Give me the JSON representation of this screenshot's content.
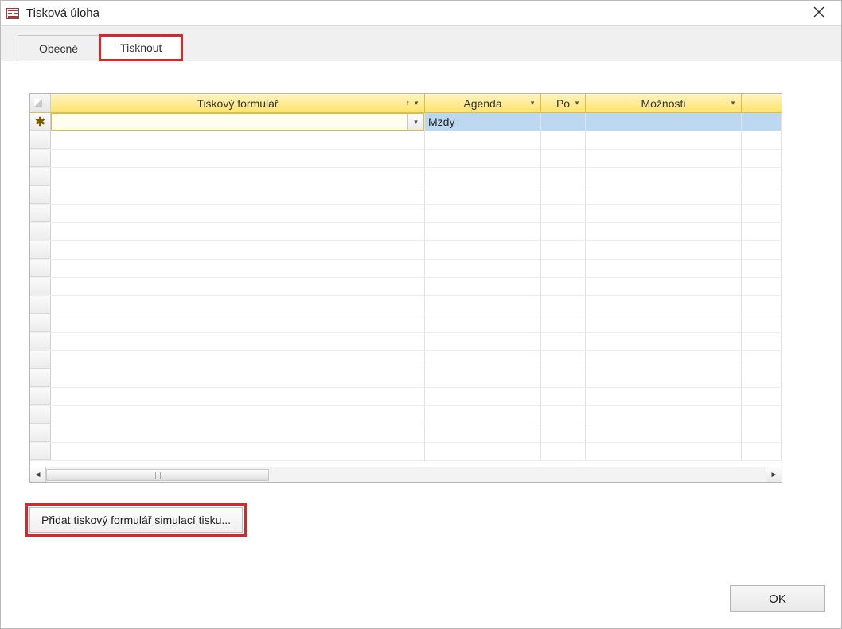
{
  "window": {
    "title": "Tisková úloha"
  },
  "tabs": {
    "items": [
      {
        "label": "Obecné",
        "active": false
      },
      {
        "label": "Tisknout",
        "active": true,
        "highlight": true
      }
    ]
  },
  "grid": {
    "columns": {
      "col1": "Tiskový formulář",
      "col2": "Agenda",
      "col3": "Po",
      "col4": "Možnosti"
    },
    "rows": [
      {
        "new": true,
        "form": "",
        "agenda": "Mzdy",
        "po": "",
        "options": ""
      }
    ]
  },
  "actions": {
    "add_sim": "Přidat tiskový formulář simulací tisku..."
  },
  "buttons": {
    "ok": "OK"
  }
}
